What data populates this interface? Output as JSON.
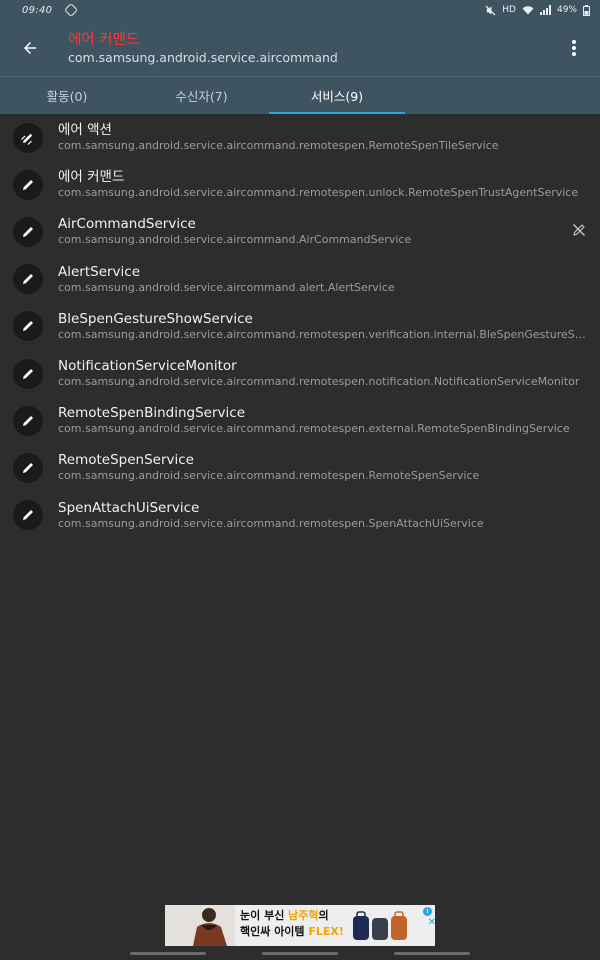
{
  "status_bar": {
    "time": "09:40",
    "mini": "HD",
    "battery": "49%"
  },
  "app_bar": {
    "title": "에어 커맨드",
    "subtitle": "com.samsung.android.service.aircommand"
  },
  "tabs": [
    {
      "label": "활동(0)",
      "active": false
    },
    {
      "label": "수신자(7)",
      "active": false
    },
    {
      "label": "서비스(9)",
      "active": true
    }
  ],
  "services": [
    {
      "name": "에어 액션",
      "package": "com.samsung.android.service.aircommand.remotespen.RemoteSpenTileService",
      "icon": "edit-pen-icon"
    },
    {
      "name": "에어 커맨드",
      "package": "com.samsung.android.service.aircommand.remotespen.unlock.RemoteSpenTrustAgentService",
      "icon": "pen-icon"
    },
    {
      "name": "AirCommandService",
      "package": "com.samsung.android.service.aircommand.AirCommandService",
      "icon": "pen-icon",
      "badge": "disabled-pen-icon"
    },
    {
      "name": "AlertService",
      "package": "com.samsung.android.service.aircommand.alert.AlertService",
      "icon": "pen-icon"
    },
    {
      "name": "BleSpenGestureShowService",
      "package": "com.samsung.android.service.aircommand.remotespen.verification.internal.BleSpenGestureShowService",
      "icon": "pen-icon"
    },
    {
      "name": "NotificationServiceMonitor",
      "package": "com.samsung.android.service.aircommand.remotespen.notification.NotificationServiceMonitor",
      "icon": "pen-icon"
    },
    {
      "name": "RemoteSpenBindingService",
      "package": "com.samsung.android.service.aircommand.remotespen.external.RemoteSpenBindingService",
      "icon": "pen-icon"
    },
    {
      "name": "RemoteSpenService",
      "package": "com.samsung.android.service.aircommand.remotespen.RemoteSpenService",
      "icon": "pen-icon"
    },
    {
      "name": "SpenAttachUiService",
      "package": "com.samsung.android.service.aircommand.remotespen.SpenAttachUiService",
      "icon": "pen-icon"
    }
  ],
  "ad": {
    "line1_a": "눈이 부신 ",
    "line1_b": "남주혁",
    "line1_c": "의",
    "line2_a": "핵인싸 아이템 ",
    "line2_b": "FLEX!"
  },
  "colors": {
    "toolbar": "#3e5561",
    "background": "#2d2d2d",
    "title_red": "#ef3b3b",
    "tab_indicator": "#2aa6e0"
  }
}
